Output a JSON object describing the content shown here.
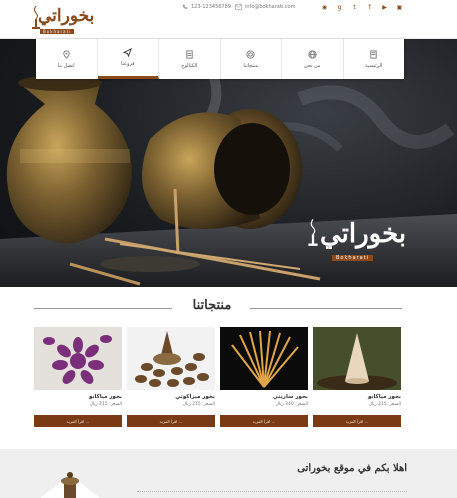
{
  "header": {
    "logo_text": "بخوراتي",
    "logo_sub": "Bokharati",
    "phone": "123-123456789",
    "email": "info@bokharati.com",
    "social_icons": [
      "rss-icon",
      "google-plus-icon",
      "twitter-icon",
      "facebook-icon",
      "youtube-icon",
      "instagram-icon"
    ]
  },
  "nav": {
    "items": [
      {
        "label": "اتصل بنا",
        "icon": "location-icon",
        "active": false
      },
      {
        "label": "فروعنا",
        "icon": "send-icon",
        "active": true
      },
      {
        "label": "الكتالوج",
        "icon": "document-icon",
        "active": false
      },
      {
        "label": "منتجاتنا",
        "icon": "box-icon",
        "active": false
      },
      {
        "label": "من نحن",
        "icon": "globe-icon",
        "active": false
      },
      {
        "label": "الرئيسية",
        "icon": "home-icon",
        "active": false
      }
    ]
  },
  "hero": {
    "brand_text": "بخوراتي",
    "brand_sub": "Bokharati"
  },
  "products": {
    "title": "منتجاتنا",
    "items": [
      {
        "name": "بخور مياكانو",
        "price": "السعر: 215 ريال",
        "button": "اقرأ المزيد ..."
      },
      {
        "name": "بخور ساريتي",
        "price": "السعر: 340 ريال",
        "button": "اقرأ المزيد ..."
      },
      {
        "name": "بخور ميراكوتي",
        "price": "السعر: 215 ريال",
        "button": "اقرأ المزيد ..."
      },
      {
        "name": "بخور مياكانو",
        "price": "السعر: 215 ريال",
        "button": "اقرأ المزيد ..."
      }
    ]
  },
  "welcome": {
    "title": "اهلا بكم في موقع بخوراتى"
  },
  "colors": {
    "brand": "#8a4a1c",
    "button": "#7a3b14"
  }
}
